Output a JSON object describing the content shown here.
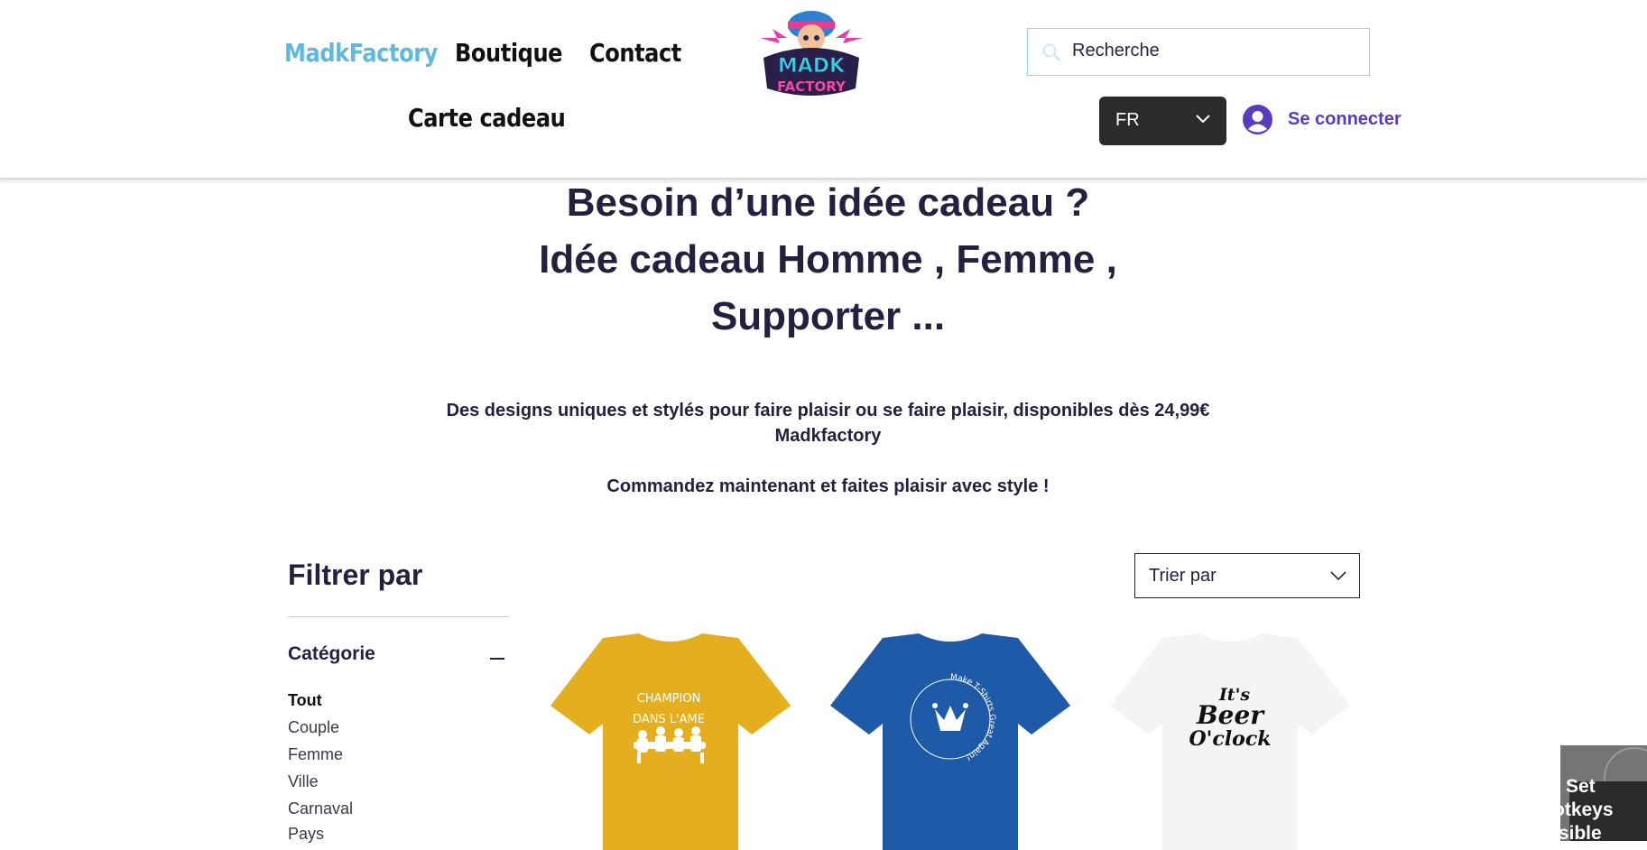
{
  "header": {
    "nav": [
      {
        "label": "MadkFactory",
        "active": true
      },
      {
        "label": "Boutique",
        "active": false
      },
      {
        "label": "Contact",
        "active": false
      },
      {
        "label": "Carte cadeau",
        "active": false
      }
    ],
    "logo_text": [
      "MADK",
      "FACTORY"
    ],
    "search": {
      "placeholder": "Recherche"
    },
    "language": {
      "value": "FR"
    },
    "login_label": "Se connecter"
  },
  "hero": {
    "lines": [
      "Besoin d’une idée cadeau ?",
      "Idée cadeau Homme , Femme ,",
      "Supporter ..."
    ]
  },
  "intro": {
    "line1": "Des designs uniques et stylés pour faire plaisir ou se faire plaisir, disponibles dès 24,99€",
    "line2": "Madkfactory",
    "line3": "Commandez maintenant et faites plaisir avec style !"
  },
  "filter": {
    "title": "Filtrer par",
    "category_title": "Catégorie",
    "categories": [
      "Tout",
      "Couple",
      "Femme",
      "Ville",
      "Carnaval",
      "Pays"
    ],
    "selected": "Tout"
  },
  "sort": {
    "label": "Trier par"
  },
  "products": [
    {
      "color": "#e5ae1f",
      "print_lines": [
        "CHAMPION",
        "DANS L'AME"
      ]
    },
    {
      "color": "#1f5aa8",
      "print_lines": [
        "Make T-Shirts Great Again!"
      ]
    },
    {
      "color": "#f2f2f2",
      "print_lines": [
        "It's",
        "Beer",
        "O'clock"
      ]
    }
  ],
  "widget": {
    "lines": [
      "Set",
      "otkeys",
      "isible"
    ]
  },
  "colors": {
    "accent": "#5eb9e2",
    "brand_purple": "#5a3bbf",
    "text_dark": "#24203f"
  }
}
